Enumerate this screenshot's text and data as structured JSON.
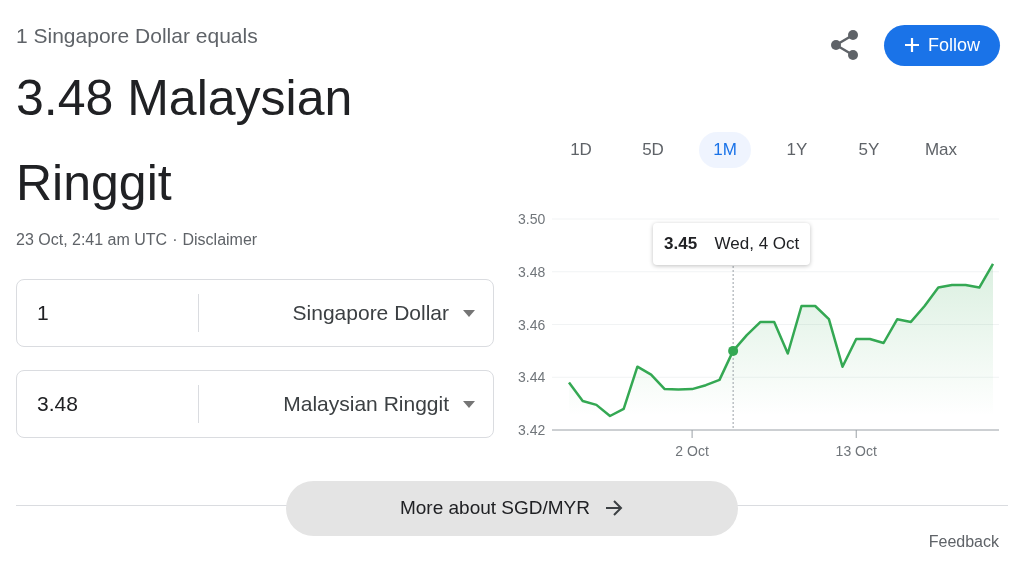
{
  "header": {
    "subtitle": "1 Singapore Dollar equals",
    "result": "3.48 Malaysian Ringgit",
    "timestamp": "23 Oct, 2:41 am UTC",
    "separator": "·",
    "disclaimer": "Disclaimer"
  },
  "actions": {
    "follow": "Follow"
  },
  "converter": [
    {
      "amount": "1",
      "currency": "Singapore Dollar"
    },
    {
      "amount": "3.48",
      "currency": "Malaysian Ringgit"
    }
  ],
  "ranges": [
    {
      "label": "1D",
      "selected": false
    },
    {
      "label": "5D",
      "selected": false
    },
    {
      "label": "1M",
      "selected": true
    },
    {
      "label": "1Y",
      "selected": false
    },
    {
      "label": "5Y",
      "selected": false
    },
    {
      "label": "Max",
      "selected": false
    }
  ],
  "chart_data": {
    "type": "area",
    "categories": [
      null,
      null,
      null,
      null,
      null,
      null,
      null,
      null,
      null,
      "2 Oct",
      null,
      null,
      null,
      null,
      null,
      null,
      null,
      null,
      null,
      null,
      null,
      "13 Oct",
      null,
      null,
      null,
      null,
      null,
      null,
      null,
      null,
      null,
      null
    ],
    "series": [
      {
        "color": "#34a853",
        "values": [
          3.438,
          3.431,
          3.4295,
          3.4253,
          3.428,
          3.444,
          3.441,
          3.4355,
          3.4354,
          3.4355,
          3.437,
          3.439,
          3.45,
          3.456,
          3.461,
          3.461,
          3.449,
          3.467,
          3.467,
          3.462,
          3.444,
          3.4545,
          3.4545,
          3.453,
          3.462,
          3.461,
          3.467,
          3.474,
          3.475,
          3.475,
          3.474,
          3.483
        ]
      }
    ],
    "ylim": [
      3.42,
      3.5
    ],
    "yticks": [
      {
        "value": 3.42,
        "label": "3.42"
      },
      {
        "value": 3.44,
        "label": "3.44"
      },
      {
        "value": 3.46,
        "label": "3.46"
      },
      {
        "value": 3.48,
        "label": "3.48"
      },
      {
        "value": 3.5,
        "label": "3.50"
      }
    ],
    "grid": true,
    "annotations": [
      "**3.45**  Wed, 4 Oct"
    ]
  },
  "more_button": "More about SGD/MYR",
  "feedback": "Feedback"
}
